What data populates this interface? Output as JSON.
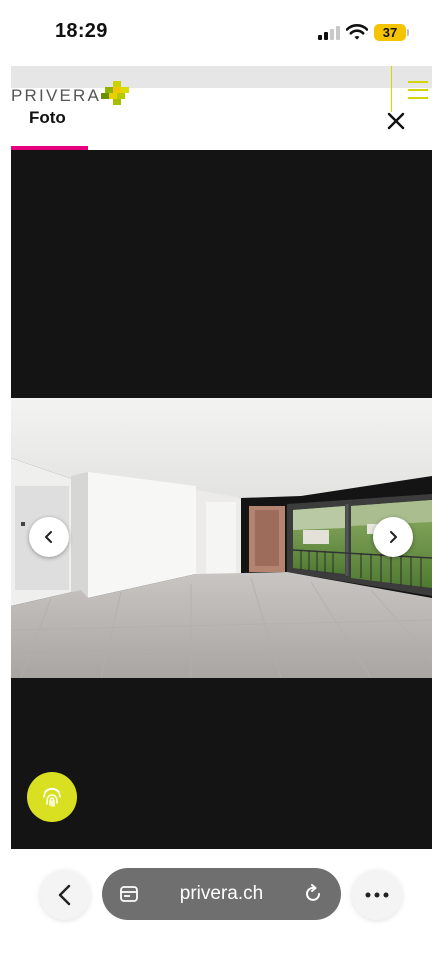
{
  "status_bar": {
    "time": "18:29",
    "battery_level": "37",
    "icons": [
      "signal-icon",
      "wifi-icon",
      "battery-icon"
    ]
  },
  "header": {
    "brand": "PRIVERA",
    "active_tab": "Foto",
    "icons": [
      "privera-logo-icon",
      "menu-icon",
      "close-icon"
    ],
    "colors": {
      "tab_indicator": "#e6007e",
      "menu": "#d4d400",
      "brand_text": "#555555"
    }
  },
  "gallery": {
    "background": "#141414",
    "photo": "empty-apartment-living-room",
    "icons": [
      "chevron-left-icon",
      "chevron-right-icon",
      "fingerprint-icon"
    ],
    "colors": {
      "fingerprint_button": "#d9e021"
    }
  },
  "browser": {
    "url": "privera.ch",
    "icons": [
      "back-icon",
      "tabs-icon",
      "reload-icon",
      "more-icon"
    ]
  }
}
